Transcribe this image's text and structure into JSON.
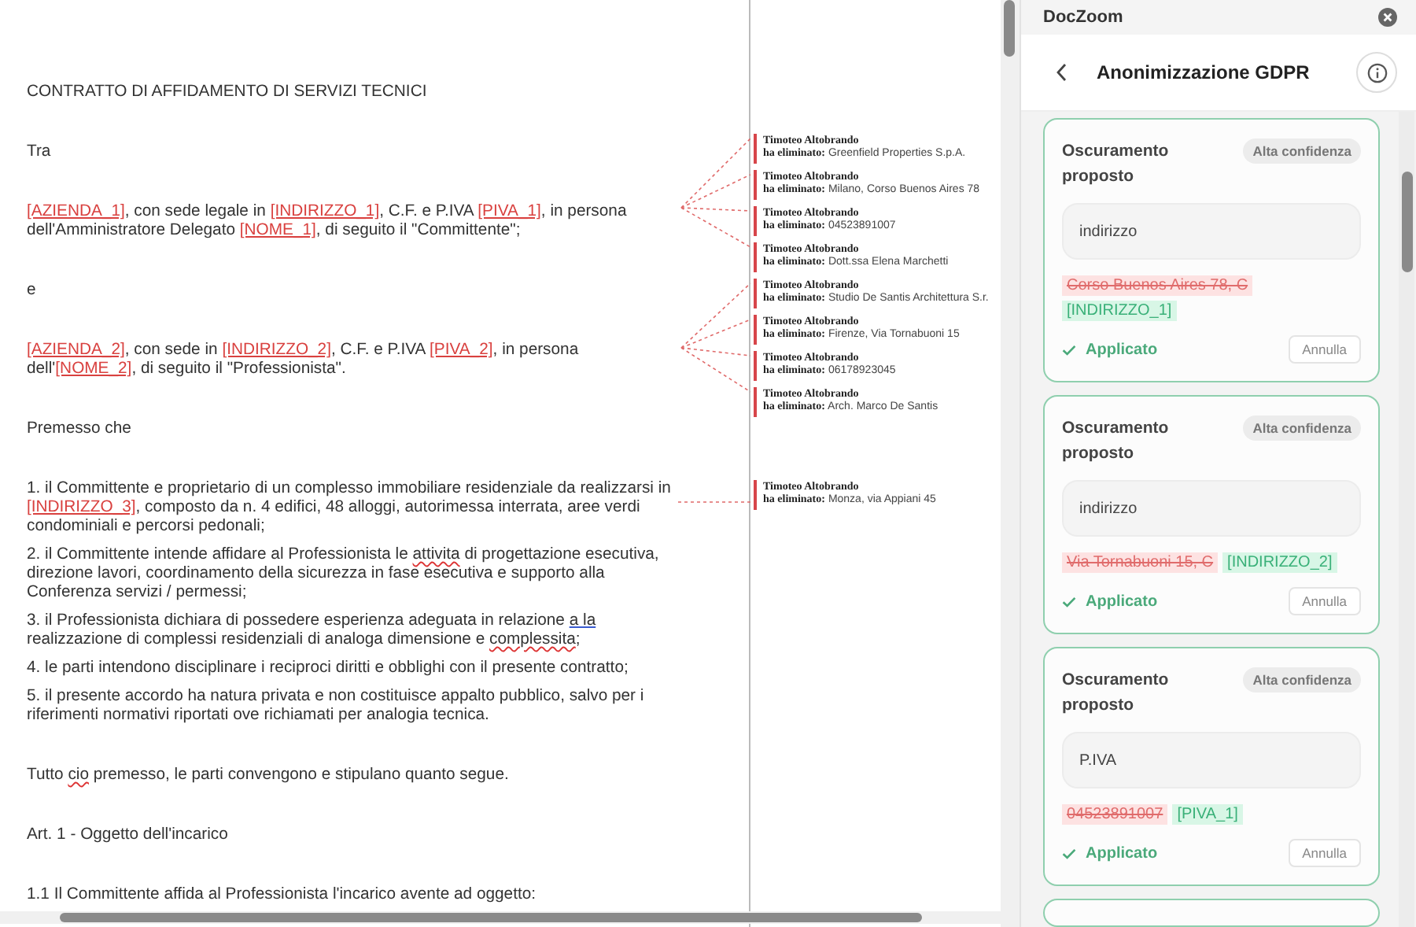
{
  "document": {
    "paragraphs": [
      {
        "kind": "paragraph",
        "segments": [
          {
            "kind": "text",
            "text": "CONTRATTO DI AFFIDAMENTO DI SERVIZI TECNICI"
          }
        ]
      },
      {
        "kind": "paragraph",
        "segments": [
          {
            "kind": "text",
            "text": "Tra"
          }
        ]
      },
      {
        "kind": "paragraph",
        "segments": [
          {
            "kind": "placeholder",
            "text": "[AZIENDA_1]"
          },
          {
            "kind": "text",
            "text": ", con sede legale in "
          },
          {
            "kind": "placeholder",
            "text": "[INDIRIZZO_1]"
          },
          {
            "kind": "text",
            "text": ", C.F. e P.IVA "
          },
          {
            "kind": "placeholder",
            "text": "[PIVA_1]"
          },
          {
            "kind": "text",
            "text": ", in persona dell'Amministratore Delegato "
          },
          {
            "kind": "placeholder",
            "text": "[NOME_1]"
          },
          {
            "kind": "text",
            "text": ", di seguito il \"Committente\";"
          }
        ]
      },
      {
        "kind": "paragraph",
        "segments": [
          {
            "kind": "text",
            "text": "e"
          }
        ]
      },
      {
        "kind": "paragraph",
        "segments": [
          {
            "kind": "placeholder",
            "text": "[AZIENDA_2]"
          },
          {
            "kind": "text",
            "text": ", con sede in "
          },
          {
            "kind": "placeholder",
            "text": "[INDIRIZZO_2]"
          },
          {
            "kind": "text",
            "text": ", C.F. e P.IVA "
          },
          {
            "kind": "placeholder",
            "text": "[PIVA_2]"
          },
          {
            "kind": "text",
            "text": ", in persona dell'"
          },
          {
            "kind": "placeholder",
            "text": "[NOME_2]"
          },
          {
            "kind": "text",
            "text": ", di seguito il \"Professionista\"."
          }
        ]
      },
      {
        "kind": "paragraph",
        "segments": [
          {
            "kind": "text",
            "text": "Premesso che"
          }
        ]
      },
      {
        "kind": "list_item",
        "segments": [
          {
            "kind": "text",
            "text": "1. il Committente e proprietario di un complesso immobiliare residenziale da realizzarsi in "
          },
          {
            "kind": "placeholder",
            "text": "[INDIRIZZO_3]"
          },
          {
            "kind": "text",
            "text": ", composto da n. 4 edifici, 48 alloggi, autorimessa interrata, aree verdi condominiali e percorsi pedonali;"
          }
        ]
      },
      {
        "kind": "list_item",
        "segments": [
          {
            "kind": "text",
            "text": "2. il Committente intende affidare al Professionista le "
          },
          {
            "kind": "spelling",
            "text": "attivita"
          },
          {
            "kind": "text",
            "text": " di progettazione esecutiva, direzione lavori, coordinamento della sicurezza in fase esecutiva e supporto alla Conferenza servizi / permessi;"
          }
        ]
      },
      {
        "kind": "list_item",
        "segments": [
          {
            "kind": "text",
            "text": "3. il Professionista dichiara di possedere esperienza adeguata in relazione "
          },
          {
            "kind": "grammar",
            "text": "a la"
          },
          {
            "kind": "text",
            "text": " realizzazione di complessi residenziali di analoga dimensione e "
          },
          {
            "kind": "spelling",
            "text": "complessita"
          },
          {
            "kind": "text",
            "text": ";"
          }
        ]
      },
      {
        "kind": "list_item",
        "segments": [
          {
            "kind": "text",
            "text": "4. le parti intendono disciplinare i reciproci diritti e obblighi con il presente contratto;"
          }
        ]
      },
      {
        "kind": "list_item",
        "segments": [
          {
            "kind": "text",
            "text": "5. il presente accordo ha natura privata e non costituisce appalto pubblico, salvo per i riferimenti normativi riportati ove richiamati per analogia tecnica."
          }
        ]
      },
      {
        "kind": "paragraph",
        "segments": [
          {
            "kind": "text",
            "text": "Tutto "
          },
          {
            "kind": "spelling",
            "text": "cio"
          },
          {
            "kind": "text",
            "text": " premesso, le parti convengono e stipulano quanto segue."
          }
        ]
      },
      {
        "kind": "paragraph",
        "segments": [
          {
            "kind": "text",
            "text": "Art. 1 - Oggetto dell'incarico"
          }
        ]
      },
      {
        "kind": "paragraph",
        "segments": [
          {
            "kind": "text",
            "text": "1.1 Il Committente affida al Professionista l'incarico avente ad oggetto:"
          }
        ]
      }
    ],
    "comments": [
      {
        "author": "Timoteo Altobrando",
        "label": "ha eliminato:",
        "value": "Greenfield Properties S.p.A."
      },
      {
        "author": "Timoteo Altobrando",
        "label": "ha eliminato:",
        "value": "Milano, Corso Buenos Aires 78"
      },
      {
        "author": "Timoteo Altobrando",
        "label": "ha eliminato:",
        "value": "04523891007"
      },
      {
        "author": "Timoteo Altobrando",
        "label": "ha eliminato:",
        "value": "Dott.ssa Elena Marchetti"
      },
      {
        "author": "Timoteo Altobrando",
        "label": "ha eliminato:",
        "value": "Studio De Santis Architettura S.r."
      },
      {
        "author": "Timoteo Altobrando",
        "label": "ha eliminato:",
        "value": "Firenze, Via Tornabuoni 15"
      },
      {
        "author": "Timoteo Altobrando",
        "label": "ha eliminato:",
        "value": "06178923045"
      },
      {
        "author": "Timoteo Altobrando",
        "label": "ha eliminato:",
        "value": "Arch. Marco De Santis"
      },
      {
        "author": "Timoteo Altobrando",
        "label": "ha eliminato:",
        "value": "Monza, via Appiani 45"
      }
    ]
  },
  "panel": {
    "app_name": "DocZoom",
    "title": "Anonimizzazione GDPR",
    "cards": [
      {
        "title": "Oscuramento proposto",
        "confidence": "Alta confidenza",
        "field_value": "indirizzo",
        "original": "Corso Buenos Aires 78, C",
        "replacement": "[INDIRIZZO_1]",
        "applied": true,
        "status": "Applicato",
        "undo_label": "Annulla"
      },
      {
        "title": "Oscuramento proposto",
        "confidence": "Alta confidenza",
        "field_value": "indirizzo",
        "original": "Via Tornabuoni 15, C",
        "replacement": "[INDIRIZZO_2]",
        "applied": true,
        "status": "Applicato",
        "undo_label": "Annulla"
      },
      {
        "title": "Oscuramento proposto",
        "confidence": "Alta confidenza",
        "field_value": "P.IVA",
        "original": "04523891007",
        "replacement": "[PIVA_1]",
        "applied": true,
        "status": "Applicato",
        "undo_label": "Annulla"
      }
    ]
  }
}
